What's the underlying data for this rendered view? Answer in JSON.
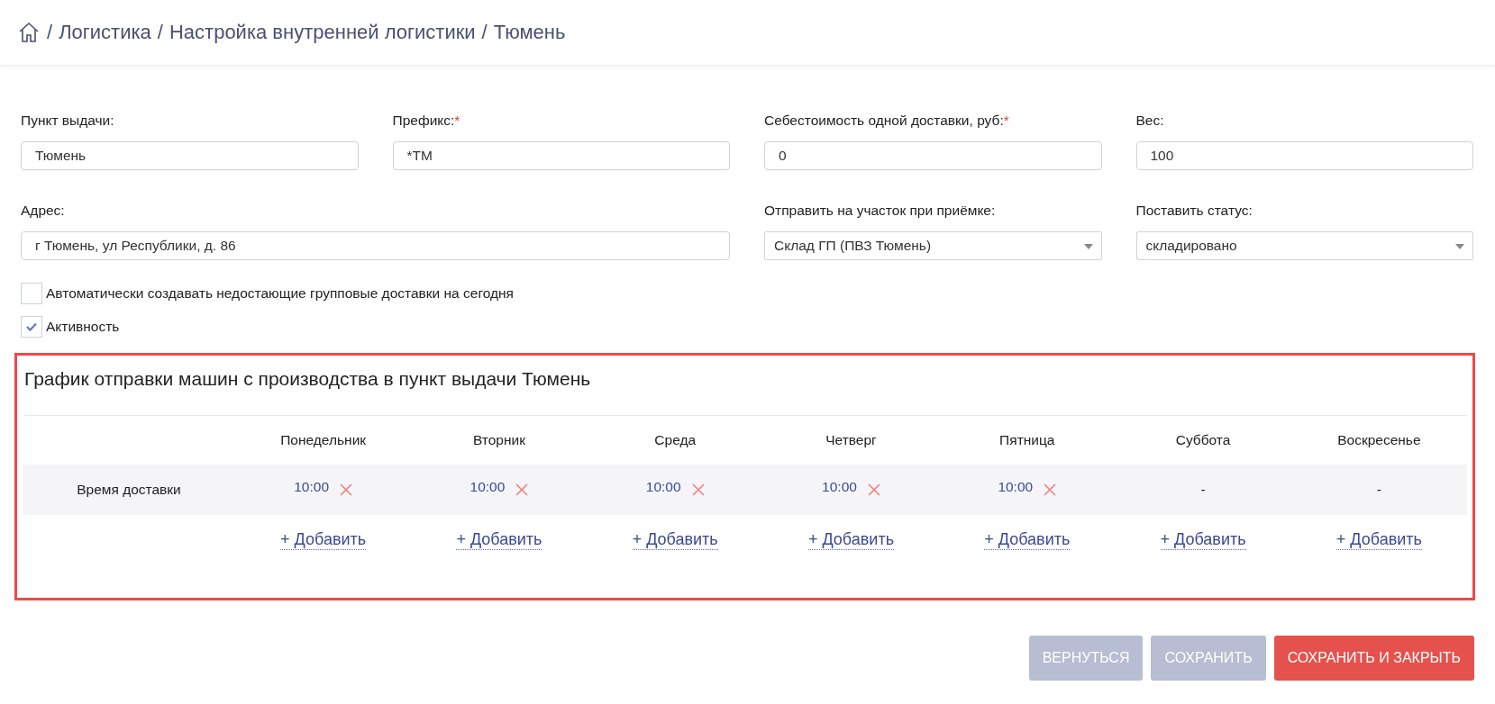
{
  "breadcrumb": [
    "Логистика",
    "Настройка внутренней логистики",
    "Тюмень"
  ],
  "breadcrumb_separator": "/",
  "field_rows": [
    [
      {
        "kind": "input",
        "label": "Пункт выдачи:",
        "value": "Тюмень"
      },
      {
        "kind": "input",
        "label": "Префикс:",
        "required_mark": "*",
        "value": "*ТМ"
      },
      {
        "kind": "input",
        "label": "Себестоимость одной доставки, руб:",
        "required_mark": "*",
        "value": "0"
      },
      {
        "kind": "input",
        "label": "Вес:",
        "value": "100"
      }
    ],
    [
      {
        "kind": "input",
        "label": "Адрес:",
        "value": "г Тюмень, ул Республики, д. 86"
      },
      {
        "kind": "select",
        "label": "Отправить на участок при приёмке:",
        "value": "Склад ГП (ПВЗ Тюмень)"
      },
      {
        "kind": "select",
        "label": "Поставить статус:",
        "value": "складировано"
      }
    ]
  ],
  "checkboxes": [
    {
      "label": "Автоматически создавать недостающие групповые доставки на сегодня",
      "checked": false
    },
    {
      "label": "Активность",
      "checked": true
    }
  ],
  "schedule": {
    "title": "График отправки машин с производства в пункт выдачи Тюмень",
    "row_label": "Время доставки",
    "days": [
      {
        "day": "Понедельник",
        "times": [
          "10:00"
        ],
        "add": "+ Добавить"
      },
      {
        "day": "Вторник",
        "times": [
          "10:00"
        ],
        "add": "+ Добавить"
      },
      {
        "day": "Среда",
        "times": [
          "10:00"
        ],
        "add": "+ Добавить"
      },
      {
        "day": "Четверг",
        "times": [
          "10:00"
        ],
        "add": "+ Добавить"
      },
      {
        "day": "Пятница",
        "times": [
          "10:00"
        ],
        "add": "+ Добавить"
      },
      {
        "day": "Суббота",
        "empty": "-",
        "add": "+ Добавить"
      },
      {
        "day": "Воскресенье",
        "empty": "-",
        "add": "+ Добавить"
      }
    ]
  },
  "buttons": [
    {
      "label": "ВЕРНУТЬСЯ",
      "kind": "secondary"
    },
    {
      "label": "СОХРАНИТЬ",
      "kind": "secondary"
    },
    {
      "label": "СОХРАНИТЬ И ЗАКРЫТЬ",
      "kind": "primary"
    }
  ]
}
